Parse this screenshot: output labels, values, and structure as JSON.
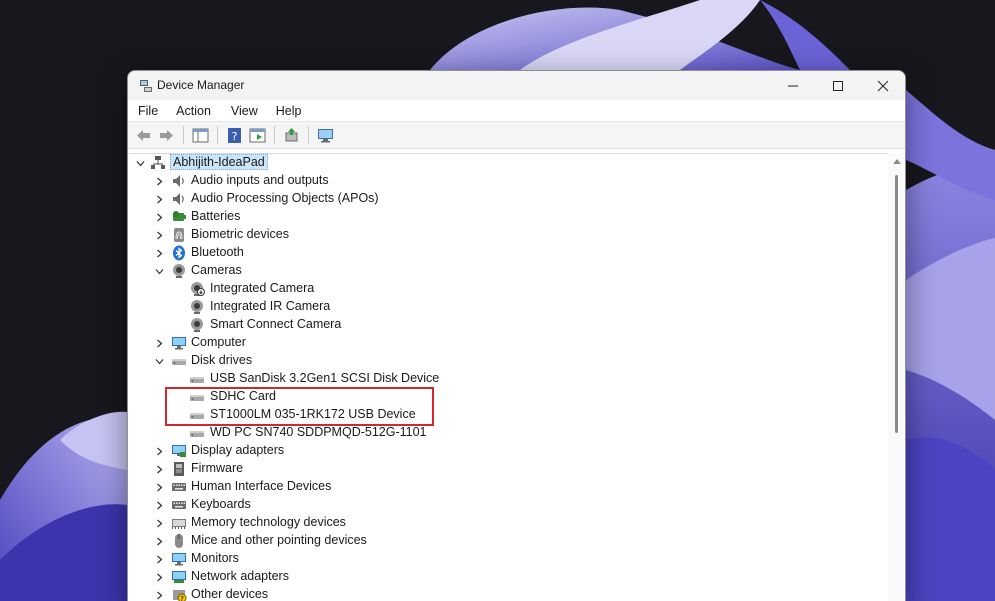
{
  "window": {
    "title": "Device Manager"
  },
  "menu": [
    "File",
    "Action",
    "View",
    "Help"
  ],
  "tree": {
    "root": "Abhijith-IdeaPad",
    "items": [
      {
        "label": "Audio inputs and outputs",
        "expanded": false,
        "icon": "speaker-icon",
        "level": 1
      },
      {
        "label": "Audio Processing Objects (APOs)",
        "expanded": false,
        "icon": "speaker-icon",
        "level": 1
      },
      {
        "label": "Batteries",
        "expanded": false,
        "icon": "battery-icon",
        "level": 1
      },
      {
        "label": "Biometric devices",
        "expanded": false,
        "icon": "fingerprint-icon",
        "level": 1
      },
      {
        "label": "Bluetooth",
        "expanded": false,
        "icon": "bluetooth-icon",
        "level": 1
      },
      {
        "label": "Cameras",
        "expanded": true,
        "icon": "camera-icon",
        "level": 1
      },
      {
        "label": "Integrated Camera",
        "icon": "camera-warning-icon",
        "level": 2
      },
      {
        "label": "Integrated IR Camera",
        "icon": "camera-icon",
        "level": 2
      },
      {
        "label": "Smart Connect Camera",
        "icon": "camera-icon",
        "level": 2
      },
      {
        "label": "Computer",
        "expanded": false,
        "icon": "monitor-icon",
        "level": 1
      },
      {
        "label": "Disk drives",
        "expanded": true,
        "icon": "drive-icon",
        "level": 1
      },
      {
        "label": "USB  SanDisk 3.2Gen1 SCSI Disk Device",
        "icon": "drive-icon",
        "level": 2
      },
      {
        "label": "SDHC Card",
        "icon": "drive-icon",
        "level": 2
      },
      {
        "label": "ST1000LM 035-1RK172 USB Device",
        "icon": "drive-icon",
        "level": 2
      },
      {
        "label": "WD PC SN740 SDDPMQD-512G-1101",
        "icon": "drive-icon",
        "level": 2
      },
      {
        "label": "Display adapters",
        "expanded": false,
        "icon": "display-adapter-icon",
        "level": 1
      },
      {
        "label": "Firmware",
        "expanded": false,
        "icon": "firmware-icon",
        "level": 1
      },
      {
        "label": "Human Interface Devices",
        "expanded": false,
        "icon": "keyboard-icon",
        "level": 1
      },
      {
        "label": "Keyboards",
        "expanded": false,
        "icon": "keyboard-icon",
        "level": 1
      },
      {
        "label": "Memory technology devices",
        "expanded": false,
        "icon": "memory-icon",
        "level": 1
      },
      {
        "label": "Mice and other pointing devices",
        "expanded": false,
        "icon": "mouse-icon",
        "level": 1
      },
      {
        "label": "Monitors",
        "expanded": false,
        "icon": "monitor-icon",
        "level": 1
      },
      {
        "label": "Network adapters",
        "expanded": false,
        "icon": "network-icon",
        "level": 1
      },
      {
        "label": "Other devices",
        "expanded": false,
        "icon": "unknown-device-icon",
        "level": 1
      }
    ]
  },
  "colors": {
    "highlight": "#d0282c",
    "selection": "#cce4f7"
  }
}
